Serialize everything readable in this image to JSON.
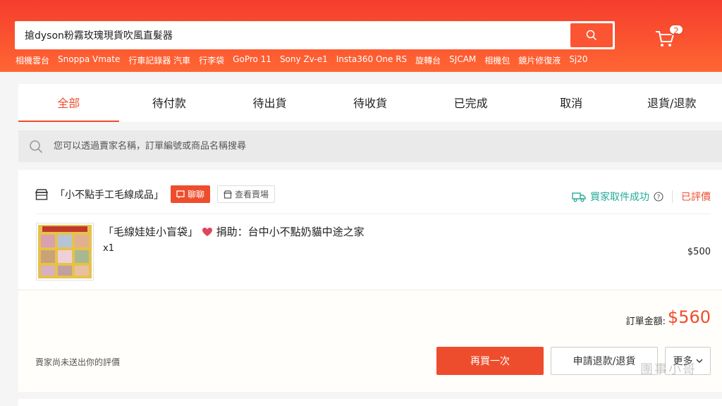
{
  "header": {
    "search_value": "搶dyson粉霧玫瑰現貨吹風直髮器",
    "cart_count": "2",
    "keywords": [
      "相機雲台",
      "Snoppa Vmate",
      "行車記錄器 汽車",
      "行李袋",
      "GoPro 11",
      "Sony Zv-e1",
      "Insta360 One RS",
      "旋轉台",
      "SJCAM",
      "相機包",
      "鏡片修復液",
      "Sj20"
    ]
  },
  "tabs": [
    "全部",
    "待付款",
    "待出貨",
    "待收貨",
    "已完成",
    "取消",
    "退貨/退款"
  ],
  "order_search": {
    "placeholder": "您可以透過賣家名稱，訂單編號或商品名稱搜尋"
  },
  "order": {
    "shop_name": "「小不點手工毛線成品」",
    "chat_label": "聊聊",
    "view_shop_label": "查看賣場",
    "status": "買家取件成功",
    "rating_status": "已評價",
    "product_name_a": "「毛線娃娃小盲袋」",
    "product_name_b": "捐助：台中小不點奶貓中途之家",
    "quantity": "x1",
    "price": "$500",
    "total_label": "訂單金額:",
    "total_value": "$560",
    "review_note": "賣家尚未送出你的評價",
    "rebuy_label": "再買一次",
    "refund_label": "申請退款/退貨",
    "more_label": "更多"
  },
  "watermark": "團事小哥",
  "colors": {
    "brand": "#ee4d2d",
    "status": "#26aa99"
  }
}
